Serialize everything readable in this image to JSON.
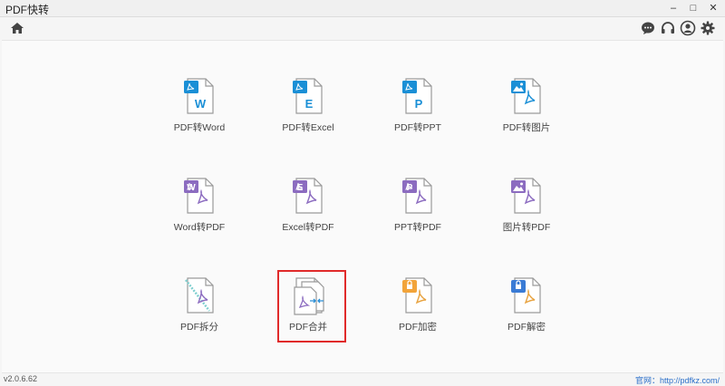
{
  "app": {
    "title": "PDF快转",
    "version": "v2.0.6.62"
  },
  "window_controls": {
    "minimize": "–",
    "maximize": "□",
    "close": "✕"
  },
  "toolbar": {
    "home_icon": "home-icon",
    "right_icons": [
      "chat-icon",
      "headset-icon",
      "user-icon",
      "gear-icon"
    ]
  },
  "tools": [
    {
      "label": "PDF转Word",
      "letter": "W",
      "color": "#1a8fd6"
    },
    {
      "label": "PDF转Excel",
      "letter": "E",
      "color": "#1a8fd6"
    },
    {
      "label": "PDF转PPT",
      "letter": "P",
      "color": "#1a8fd6"
    },
    {
      "label": "PDF转图片",
      "letter": "",
      "color": "#1a8fd6"
    },
    {
      "label": "Word转PDF",
      "letter": "W",
      "color": "#8c6cc0"
    },
    {
      "label": "Excel转PDF",
      "letter": "E",
      "color": "#8c6cc0"
    },
    {
      "label": "PPT转PDF",
      "letter": "P",
      "color": "#8c6cc0"
    },
    {
      "label": "图片转PDF",
      "letter": "",
      "color": "#8c6cc0"
    },
    {
      "label": "PDF拆分",
      "letter": "",
      "color": "#8c6cc0"
    },
    {
      "label": "PDF合并",
      "letter": "",
      "color": "#8c6cc0"
    },
    {
      "label": "PDF加密",
      "letter": "",
      "color": "#f2a43a"
    },
    {
      "label": "PDF解密",
      "letter": "",
      "color": "#3a7bd5"
    }
  ],
  "selected_tool": "PDF合并",
  "footer": {
    "site": "官网：http://pdfkz.com/"
  }
}
